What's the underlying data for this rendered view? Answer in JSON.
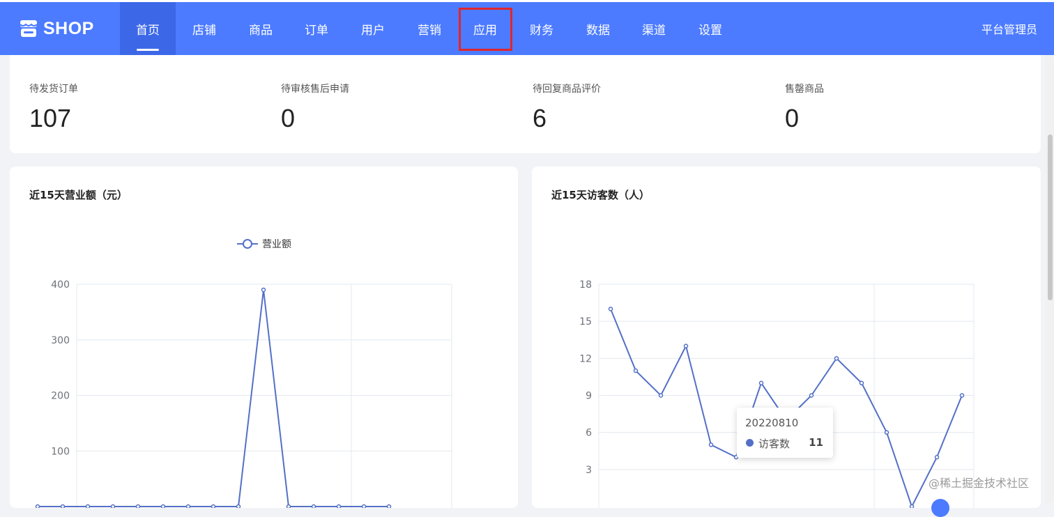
{
  "app": {
    "logo_text": "SHOP"
  },
  "nav": {
    "items": [
      "首页",
      "店铺",
      "商品",
      "订单",
      "用户",
      "营销",
      "应用",
      "财务",
      "数据",
      "渠道",
      "设置"
    ],
    "active_index": 0,
    "highlighted_index": 6
  },
  "user": {
    "name": "平台管理员"
  },
  "stats": [
    {
      "label": "待发货订单",
      "value": "107"
    },
    {
      "label": "待审核售后申请",
      "value": "0"
    },
    {
      "label": "待回复商品评价",
      "value": "6"
    },
    {
      "label": "售罄商品",
      "value": "0"
    }
  ],
  "colors": {
    "brand": "#4c7bff",
    "series": "#5470c6",
    "highlight": "#e0262c"
  },
  "chart_data": [
    {
      "type": "line",
      "title": "近15天营业额（元）",
      "legend": [
        "营业额"
      ],
      "legend_position": "top-center",
      "yticks": [
        100,
        200,
        300,
        400
      ],
      "ylim": [
        0,
        400
      ],
      "grid": true,
      "series": [
        {
          "name": "营业额",
          "values": [
            0,
            0,
            0,
            0,
            0,
            0,
            0,
            0,
            0,
            390,
            0,
            0,
            0,
            0,
            0
          ]
        }
      ]
    },
    {
      "type": "line",
      "title": "近15天访客数（人）",
      "yticks": [
        3,
        6,
        9,
        12,
        15,
        18
      ],
      "ylim": [
        0,
        18
      ],
      "grid": true,
      "series": [
        {
          "name": "访客数",
          "values": [
            16,
            11,
            9,
            13,
            5,
            4,
            10,
            7,
            9,
            12,
            10,
            6,
            0,
            4,
            9
          ]
        }
      ],
      "tooltip": {
        "date": "20220810",
        "series": "访客数",
        "value": "11"
      }
    }
  ],
  "watermark": "@稀土掘金技术社区"
}
